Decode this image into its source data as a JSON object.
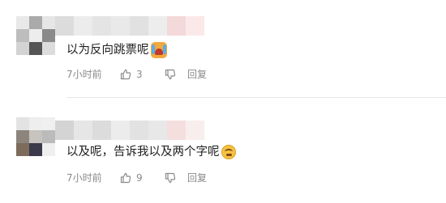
{
  "comments": [
    {
      "avatar_colors": [
        "#e9e9e9",
        "#aaaaaa",
        "#e6e6e6",
        "#bdbdbd",
        "#ededed",
        "#8a8a8a",
        "#d3d3d3",
        "#555555",
        "#dcdcdc"
      ],
      "name_colors": [
        "#dcdcdc",
        "#ececec",
        "#e4e4e4",
        "#e9e9e9",
        "#e1e1e1",
        "#ededed",
        "#f3d9d9",
        "#fbe9e9"
      ],
      "text": "以为反向跳票呢",
      "emoji_icon": "crying-face-emoji",
      "time": "7小时前",
      "like_icon": "thumbs-up-icon",
      "like_count": "3",
      "dislike_icon": "thumbs-down-icon",
      "reply_label": "回复"
    },
    {
      "avatar_colors": [
        "#e3e3e3",
        "#eeeeee",
        "#f0f0f0",
        "#8c847d",
        "#c7c3bf",
        "#bbbbbb",
        "#7d6c5c",
        "#3a3a4a",
        "#efefef"
      ],
      "name_colors": [
        "#d4d4d4",
        "#e6e6e6",
        "#dcdcdc",
        "#ececec",
        "#e2e2e2",
        "#e8e8e8",
        "#f5dede",
        "#f8eeee"
      ],
      "text": "以及呢，告诉我以及两个字呢",
      "emoji_icon": "dizzy-face-emoji",
      "time": "7小时前",
      "like_icon": "thumbs-up-icon",
      "like_count": "9",
      "dislike_icon": "thumbs-down-icon",
      "reply_label": "回复"
    }
  ],
  "colors": {
    "meta_text": "#8a8a8a",
    "divider": "#e8e8e8"
  }
}
